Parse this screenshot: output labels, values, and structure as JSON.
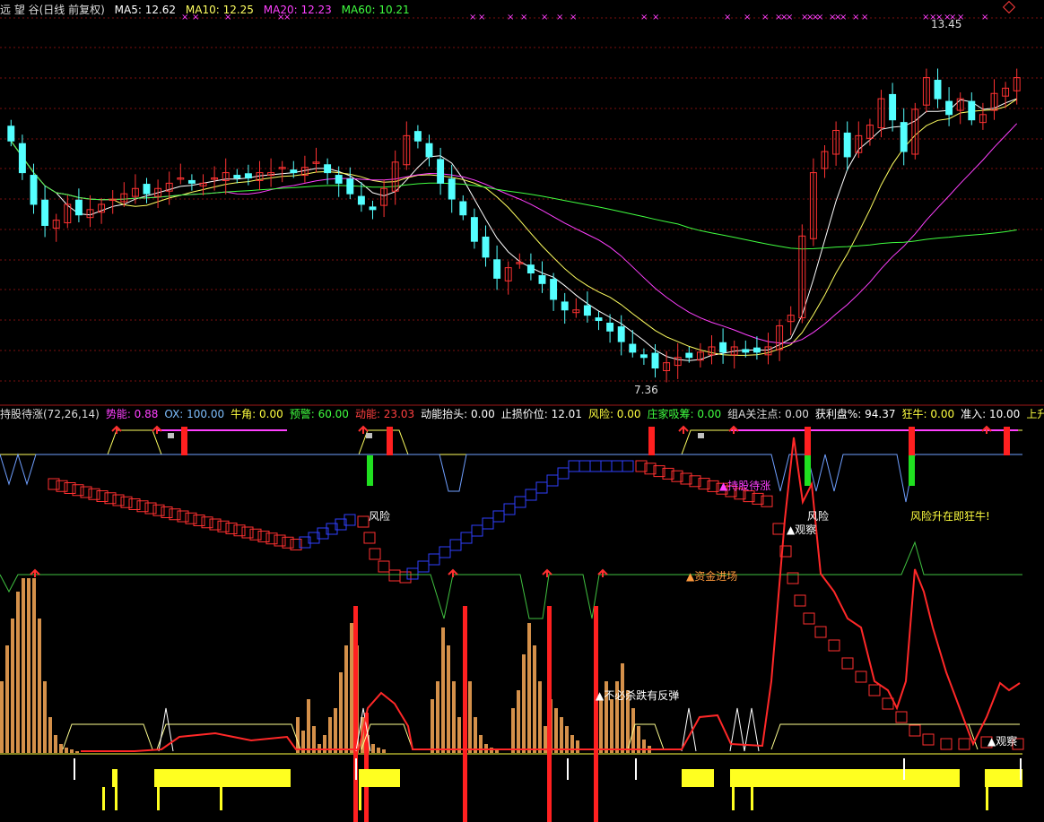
{
  "top_header": {
    "title": "远 望 谷(日线 前复权)",
    "items": [
      {
        "label": "MA5: 12.62",
        "color": "#ffffff"
      },
      {
        "label": "MA10: 12.25",
        "color": "#ffff60"
      },
      {
        "label": "MA20: 12.23",
        "color": "#ff40ff"
      },
      {
        "label": "MA60: 10.21",
        "color": "#40ff40"
      }
    ]
  },
  "indicator_header": {
    "items": [
      {
        "label": "持股待涨(72,26,14)",
        "color": "#dddddd"
      },
      {
        "label": "势能: 0.88",
        "color": "#ff40ff"
      },
      {
        "label": "OX: 100.00",
        "color": "#7fbfff"
      },
      {
        "label": "牛角: 0.00",
        "color": "#ffff40"
      },
      {
        "label": "预警: 60.00",
        "color": "#40ff40"
      },
      {
        "label": "动能: 23.03",
        "color": "#ff4040"
      },
      {
        "label": "动能抬头: 0.00",
        "color": "#ffffff"
      },
      {
        "label": "止损价位: 12.01",
        "color": "#ffffff"
      },
      {
        "label": "风险: 0.00",
        "color": "#ffff40"
      },
      {
        "label": "庄家吸筹: 0.00",
        "color": "#40ff40"
      },
      {
        "label": "组A关注点: 0.00",
        "color": "#dddddd"
      },
      {
        "label": "获利盘%: 94.37",
        "color": "#ffffff"
      },
      {
        "label": "狂牛: 0.00",
        "color": "#ffff40"
      },
      {
        "label": "准入: 10.00",
        "color": "#ffffff"
      },
      {
        "label": "上升趋",
        "color": "#ffff40"
      }
    ]
  },
  "annotations": {
    "high_label": "13.45",
    "low_label": "7.36",
    "hold": "▲持股待涨",
    "risk1": "风险",
    "risk2": "风险",
    "observe1": "▲观察",
    "observe2": "▲观察",
    "risk_rise": "风险升在即狂牛!",
    "capital": "▲资金进场",
    "no_chase": "▲不必杀跌有反弹"
  },
  "colors": {
    "up": "#ff3232",
    "down": "#54ffff",
    "ma5": "#ffffff",
    "ma10": "#ffff60",
    "ma20": "#ff40ff",
    "ma60": "#40ff40"
  },
  "chart_data": {
    "type": "candlestick",
    "title": "远 望 谷(日线 前复权)",
    "price_range": [
      7.0,
      14.3
    ],
    "annotated_high": 13.45,
    "annotated_low": 7.36,
    "ma_latest": {
      "MA5": 12.62,
      "MA10": 12.25,
      "MA20": 12.23,
      "MA60": 10.21
    },
    "close": [
      11.8,
      11.2,
      10.6,
      10.2,
      10.3,
      10.6,
      10.4,
      10.5,
      10.6,
      10.7,
      10.8,
      10.9,
      10.8,
      10.9,
      11.0,
      11.1,
      11.0,
      11.0,
      11.1,
      11.2,
      11.1,
      11.1,
      11.2,
      11.2,
      11.3,
      11.2,
      11.3,
      11.4,
      11.2,
      11.0,
      10.8,
      10.6,
      10.5,
      10.9,
      11.4,
      11.9,
      11.8,
      11.5,
      11.0,
      10.7,
      10.4,
      9.9,
      9.6,
      9.2,
      9.4,
      9.5,
      9.3,
      9.1,
      8.8,
      8.6,
      8.6,
      8.5,
      8.4,
      8.2,
      8.0,
      7.8,
      7.7,
      7.5,
      7.6,
      7.7,
      7.7,
      7.8,
      7.9,
      7.8,
      7.9,
      7.8,
      7.8,
      7.9,
      8.3,
      8.5,
      10.0,
      11.2,
      11.6,
      12.0,
      11.5,
      11.9,
      12.1,
      12.6,
      12.2,
      11.6,
      12.4,
      13.0,
      12.6,
      12.3,
      12.6,
      12.2,
      12.3,
      12.7,
      12.8,
      13.0
    ]
  }
}
